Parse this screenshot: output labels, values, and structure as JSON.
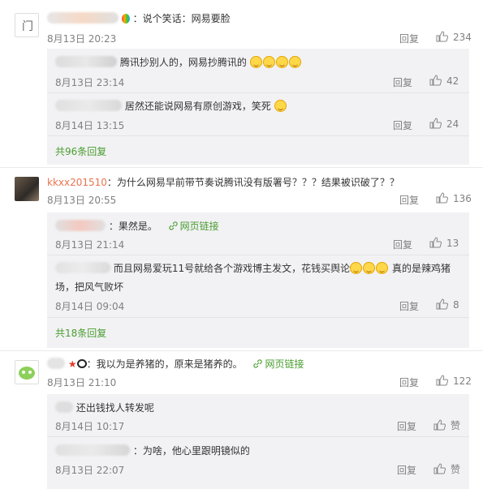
{
  "comments": [
    {
      "text": "：说个笑话：网易要脸",
      "time": "8月13日 20:23",
      "reply": "回复",
      "likes": "234",
      "sub": [
        {
          "text": "腾讯抄别人的，网易抄腾讯的",
          "time": "8月13日 23:14",
          "reply": "回复",
          "likes": "42"
        },
        {
          "text": "居然还能说网易有原创游戏，笑死",
          "time": "8月14日 13:15",
          "reply": "回复",
          "likes": "24"
        }
      ],
      "more": "共96条回复"
    },
    {
      "user": "kkxx201510",
      "text": "：为什么网易早前带节奏说腾讯没有版署号？？？结果被识破了？？",
      "time": "8月13日 20:55",
      "reply": "回复",
      "likes": "136",
      "sub": [
        {
          "text": "：果然是。",
          "link": "网页链接",
          "time": "8月13日 21:14",
          "reply": "回复",
          "likes": "13"
        },
        {
          "text": "而且网易爱玩11号就给各个游戏博主发文，花钱买舆论",
          "text2": "真的是辣鸡猪",
          "text3": "场，把风气败坏",
          "time": "8月14日 09:04",
          "reply": "回复",
          "likes": "8"
        }
      ],
      "more": "共18条回复"
    },
    {
      "text": "：我以为是养猪的，原来是猪养的。",
      "link": "网页链接",
      "time": "8月13日 21:10",
      "reply": "回复",
      "likes": "122",
      "sub": [
        {
          "text": "还出钱找人转发呢",
          "time": "8月14日 10:17",
          "reply": "回复",
          "likes": "赞"
        },
        {
          "text": "：为啥，他心里跟明镜似的",
          "time": "8月13日 22:07",
          "reply": "回复",
          "likes": "赞"
        }
      ]
    }
  ]
}
